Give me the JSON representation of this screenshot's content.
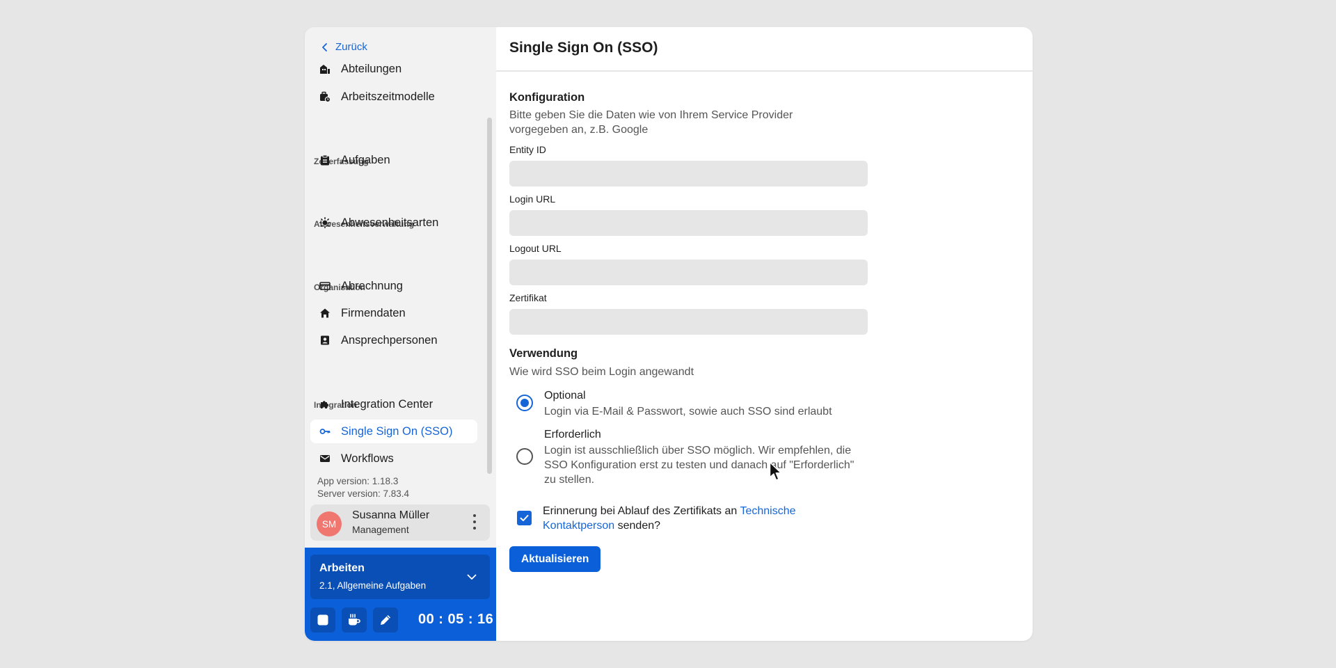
{
  "sidebar": {
    "back_label": "Zurück",
    "items": [
      {
        "label": "Abteilungen",
        "icon": "building-icon"
      },
      {
        "label": "Arbeitszeitmodelle",
        "icon": "briefcase-clock-icon"
      },
      {
        "label": "Aufgaben",
        "icon": "clipboard-icon"
      },
      {
        "label": "Abwesenheitsarten",
        "icon": "sun-icon"
      },
      {
        "label": "Abrechnung",
        "icon": "credit-card-icon"
      },
      {
        "label": "Firmendaten",
        "icon": "home-icon"
      },
      {
        "label": "Ansprechpersonen",
        "icon": "contact-badge-icon"
      },
      {
        "label": "Integration Center",
        "icon": "puzzle-icon"
      },
      {
        "label": "Single Sign On (SSO)",
        "icon": "key-icon",
        "active": true
      },
      {
        "label": "Workflows",
        "icon": "mail-icon"
      }
    ],
    "sections": {
      "zeiterfassung": "Zeiterfassung",
      "abwesenheit": "Abwesenheitsverwaltung",
      "organisation": "Organisation",
      "integration": "Integration"
    },
    "app_version": "App version: 1.18.3",
    "server_version": "Server version: 7.83.4",
    "user": {
      "initials": "SM",
      "name": "Susanna Müller",
      "role": "Management"
    }
  },
  "tracker": {
    "title": "Arbeiten",
    "subtitle": "2.1, Allgemeine Aufgaben",
    "timer": "00 : 05 : 16"
  },
  "main": {
    "title": "Single Sign On (SSO)",
    "config": {
      "heading": "Konfiguration",
      "description_line1": "Bitte geben Sie die Daten wie von Ihrem Service Provider",
      "description_line2": "vorgegeben an, z.B. Google",
      "fields": [
        {
          "label": "Entity ID",
          "value": ""
        },
        {
          "label": "Login URL",
          "value": ""
        },
        {
          "label": "Logout URL",
          "value": ""
        },
        {
          "label": "Zertifikat",
          "value": ""
        }
      ]
    },
    "usage": {
      "heading": "Verwendung",
      "description": "Wie wird SSO beim Login angewandt",
      "options": [
        {
          "title": "Optional",
          "desc": "Login via E-Mail & Passwort, sowie auch SSO sind erlaubt",
          "selected": true
        },
        {
          "title": "Erforderlich",
          "desc": "Login ist ausschließlich über SSO möglich. Wir empfehlen, die SSO Konfiguration erst zu testen und danach auf \"Erforderlich\" zu stellen.",
          "selected": false
        }
      ]
    },
    "reminder": {
      "text_before": "Erinnerung bei Ablauf des Zertifikats an ",
      "link": "Technische Kontaktperson",
      "text_after": " senden?",
      "checked": true
    },
    "submit_label": "Aktualisieren"
  },
  "colors": {
    "accent": "#1565d8",
    "tracker_bg": "#0b5fd9",
    "avatar": "#f07770"
  }
}
